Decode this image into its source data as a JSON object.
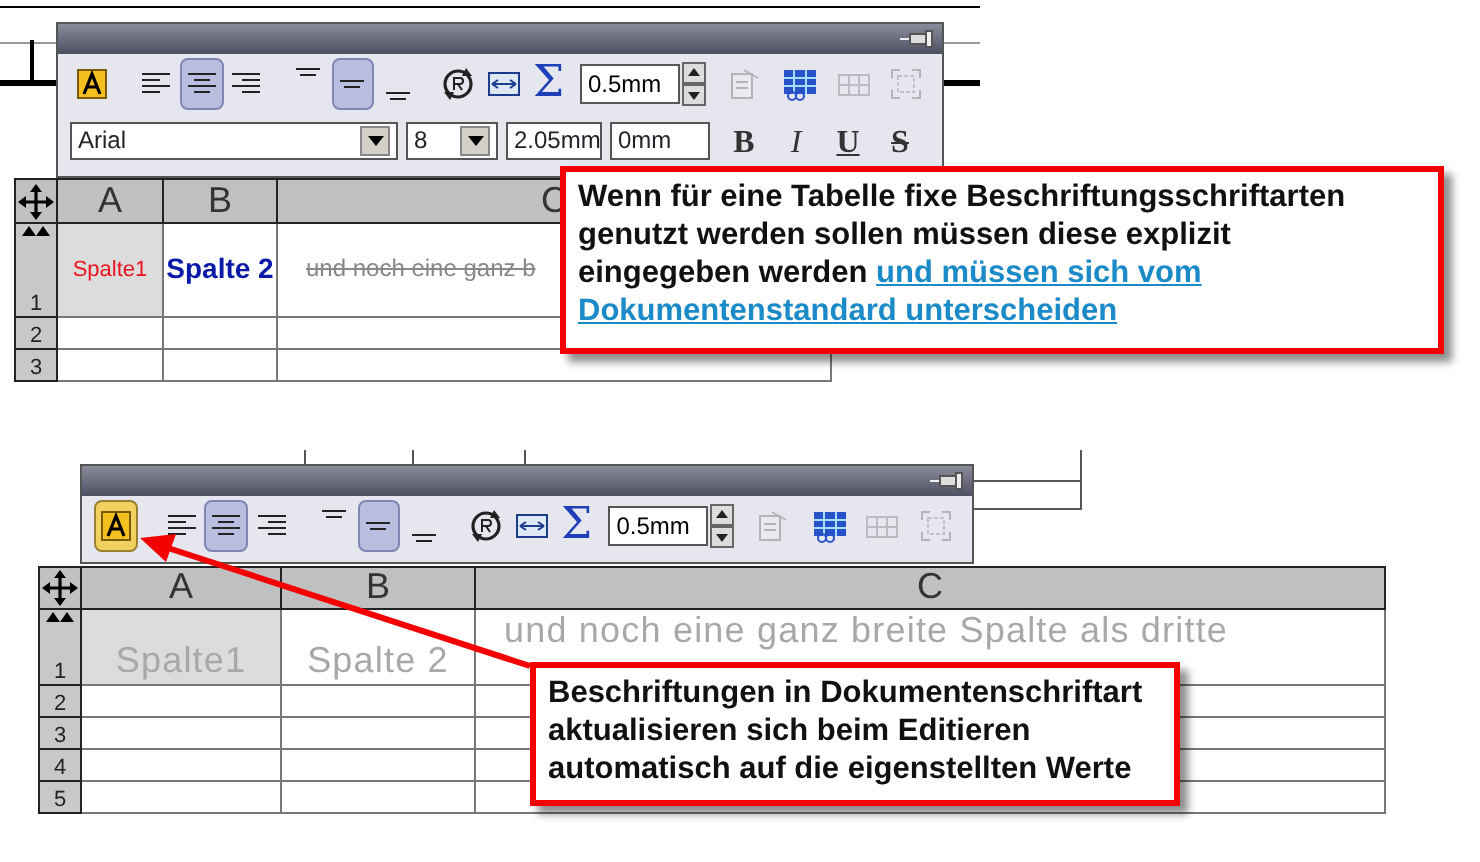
{
  "scenes": [
    {
      "toolbar": {
        "left_buttons": [
          {
            "kind": "font",
            "selected": false,
            "disabled": false
          },
          {
            "kind": "align-left",
            "selected": false,
            "disabled": false
          },
          {
            "kind": "align-center",
            "selected": true,
            "disabled": false
          },
          {
            "kind": "align-right",
            "selected": false,
            "disabled": false
          },
          {
            "kind": "valign-top",
            "selected": false,
            "disabled": false
          },
          {
            "kind": "valign-middle",
            "selected": true,
            "disabled": false
          },
          {
            "kind": "valign-bottom",
            "selected": false,
            "disabled": false
          },
          {
            "kind": "rotate",
            "selected": false,
            "disabled": false
          },
          {
            "kind": "fit",
            "selected": false,
            "disabled": false
          },
          {
            "kind": "sum",
            "glyph": "Σ",
            "selected": false,
            "disabled": false
          }
        ],
        "spin_value": "0.5mm",
        "right_buttons": [
          {
            "kind": "properties",
            "selected": false,
            "disabled": true
          },
          {
            "kind": "insert-table",
            "selected": false,
            "disabled": false
          },
          {
            "kind": "grid",
            "selected": false,
            "disabled": true
          },
          {
            "kind": "merge",
            "selected": false,
            "disabled": true
          }
        ],
        "font_row": {
          "font": "Arial",
          "size": "8",
          "height": "2.05mm",
          "spacing": "0mm",
          "styles": [
            {
              "kind": "bold",
              "label": "B"
            },
            {
              "kind": "italic",
              "label": "I"
            },
            {
              "kind": "underline",
              "label": "U"
            },
            {
              "kind": "strike",
              "label": "S"
            }
          ]
        }
      },
      "table": {
        "columns": [
          "A",
          "B",
          "C"
        ],
        "rows": [
          {
            "label": "1",
            "cells": [
              {
                "text": "Spalte1",
                "kind": "custom-red",
                "highlighted": true
              },
              {
                "text": "Spalte 2",
                "kind": "custom-bold-blue",
                "highlighted": false
              },
              {
                "text": "und noch eine ganz b",
                "kind": "custom-strike",
                "highlighted": false
              }
            ]
          },
          {
            "label": "2"
          },
          {
            "label": "3"
          }
        ]
      }
    },
    {
      "toolbar": {
        "left_buttons": [
          {
            "kind": "font",
            "selected": true,
            "disabled": false
          },
          {
            "kind": "align-left",
            "selected": false,
            "disabled": false
          },
          {
            "kind": "align-center",
            "selected": true,
            "disabled": false
          },
          {
            "kind": "align-right",
            "selected": false,
            "disabled": false
          },
          {
            "kind": "valign-top",
            "selected": false,
            "disabled": false
          },
          {
            "kind": "valign-middle",
            "selected": true,
            "disabled": false
          },
          {
            "kind": "valign-bottom",
            "selected": false,
            "disabled": false
          },
          {
            "kind": "rotate",
            "selected": false,
            "disabled": false
          },
          {
            "kind": "fit",
            "selected": false,
            "disabled": false
          },
          {
            "kind": "sum",
            "glyph": "Σ",
            "selected": false,
            "disabled": false
          }
        ],
        "spin_value": "0.5mm",
        "right_buttons": [
          {
            "kind": "properties",
            "selected": false,
            "disabled": true
          },
          {
            "kind": "insert-table",
            "selected": false,
            "disabled": false
          },
          {
            "kind": "grid",
            "selected": false,
            "disabled": true
          },
          {
            "kind": "merge",
            "selected": false,
            "disabled": true
          }
        ]
      },
      "table": {
        "columns": [
          "A",
          "B",
          "C"
        ],
        "rows": [
          {
            "label": "1",
            "cells": [
              {
                "text": "Spalte1",
                "kind": "document",
                "highlighted": true
              },
              {
                "text": "Spalte 2",
                "kind": "document",
                "highlighted": false
              },
              {
                "text": "und noch eine ganz breite Spalte als dritte",
                "kind": "document",
                "highlighted": false
              }
            ]
          },
          {
            "label": "2"
          },
          {
            "label": "3"
          },
          {
            "label": "4"
          },
          {
            "label": "5"
          }
        ]
      }
    }
  ],
  "callouts": [
    {
      "text": "Wenn für eine Tabelle fixe Beschriftungsschriftarten genutzt werden sollen müssen diese explizit eingegeben werden",
      "link_parts": [
        "und müssen sich vom",
        "Dokumentenstandard unterscheiden"
      ],
      "arrow": false
    },
    {
      "text": "Beschriftungen in Dokumentenschriftart aktualisieren sich beim Editieren automatisch auf die eigenstellten Werte",
      "arrow": true
    }
  ]
}
